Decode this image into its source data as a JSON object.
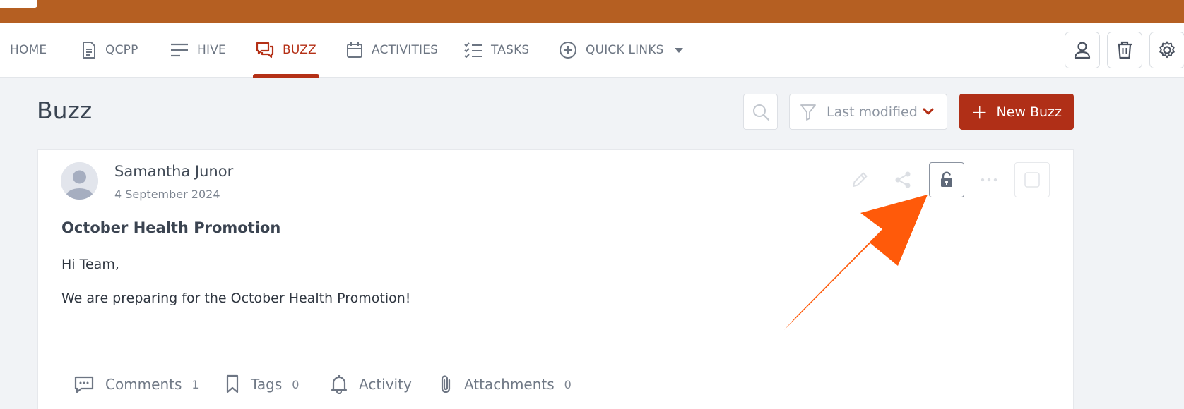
{
  "nav": {
    "items": [
      {
        "label": "HOME",
        "icon": "home-icon"
      },
      {
        "label": "QCPP",
        "icon": "document-icon"
      },
      {
        "label": "HIVE",
        "icon": "lines-icon"
      },
      {
        "label": "BUZZ",
        "icon": "chat-icon",
        "active": true
      },
      {
        "label": "ACTIVITIES",
        "icon": "calendar-icon"
      },
      {
        "label": "TASKS",
        "icon": "checklist-icon"
      },
      {
        "label": "QUICK LINKS",
        "icon": "plus-circle-icon"
      }
    ],
    "right_buttons": [
      "user-icon",
      "trash-icon",
      "gear-icon"
    ]
  },
  "page": {
    "title": "Buzz",
    "filter_label": "Last modified",
    "new_button_label": "New Buzz"
  },
  "post": {
    "author": "Samantha Junor",
    "date": "4 September 2024",
    "title": "October Health Promotion",
    "body": [
      "Hi Team,",
      "We are preparing for the October Health Promotion!"
    ],
    "tabs": [
      {
        "label": "Comments",
        "count": "1"
      },
      {
        "label": "Tags",
        "count": "0"
      },
      {
        "label": "Activity",
        "count": ""
      },
      {
        "label": "Attachments",
        "count": "0"
      }
    ]
  },
  "colors": {
    "banner": "#b55f22",
    "accent": "#b43016",
    "annotation_arrow": "#ff5a0a"
  }
}
